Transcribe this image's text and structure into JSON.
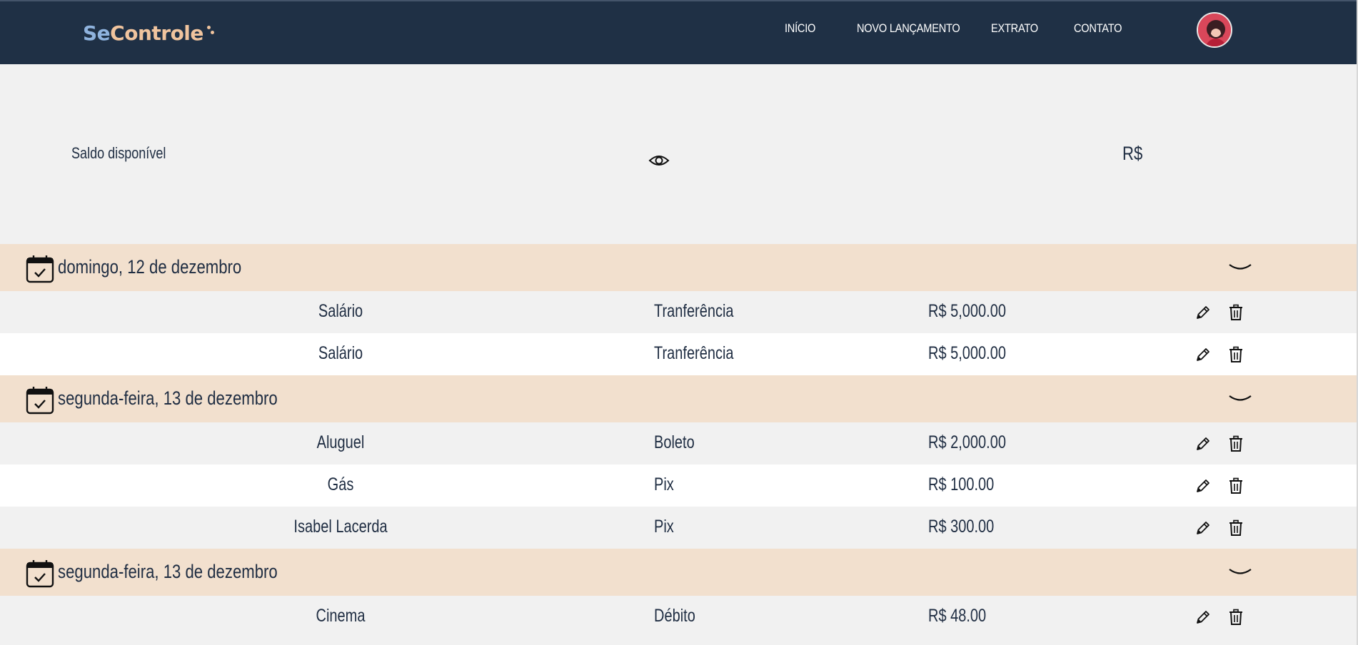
{
  "brand": {
    "logo_part1": "Se",
    "logo_part2": "Controle",
    "colors": {
      "navbar": "#1f3045",
      "logo_primary": "#8fb3de",
      "logo_accent": "#f0c49e",
      "day_header": "#f2e0ce",
      "text": "#1f2d42"
    }
  },
  "nav": {
    "items": [
      {
        "label": "INÍCIO"
      },
      {
        "label": "NOVO LANÇAMENTO"
      },
      {
        "label": "EXTRATO"
      },
      {
        "label": "CONTATO"
      }
    ],
    "avatar_icon": "user-avatar"
  },
  "balance": {
    "label": "Saldo disponível",
    "toggle_icon": "eye-icon",
    "currency": "R$"
  },
  "groups": [
    {
      "date": "domingo, 12 de dezembro",
      "transactions": [
        {
          "description": "Salário",
          "method": "Tranferência",
          "amount": "R$ 5,000.00"
        },
        {
          "description": "Salário",
          "method": "Tranferência",
          "amount": "R$ 5,000.00"
        }
      ]
    },
    {
      "date": "segunda-feira, 13 de dezembro",
      "transactions": [
        {
          "description": "Aluguel",
          "method": "Boleto",
          "amount": "R$ 2,000.00"
        },
        {
          "description": "Gás",
          "method": "Pix",
          "amount": "R$ 100.00"
        },
        {
          "description": "Isabel Lacerda",
          "method": "Pix",
          "amount": "R$ 300.00"
        }
      ]
    },
    {
      "date": "segunda-feira, 13 de dezembro",
      "transactions": [
        {
          "description": "Cinema",
          "method": "Débito",
          "amount": "R$ 48.00"
        }
      ]
    }
  ],
  "icons": {
    "calendar": "calendar-check-icon",
    "expand": "chevron-down-icon",
    "edit": "pencil-icon",
    "delete": "trash-icon"
  }
}
